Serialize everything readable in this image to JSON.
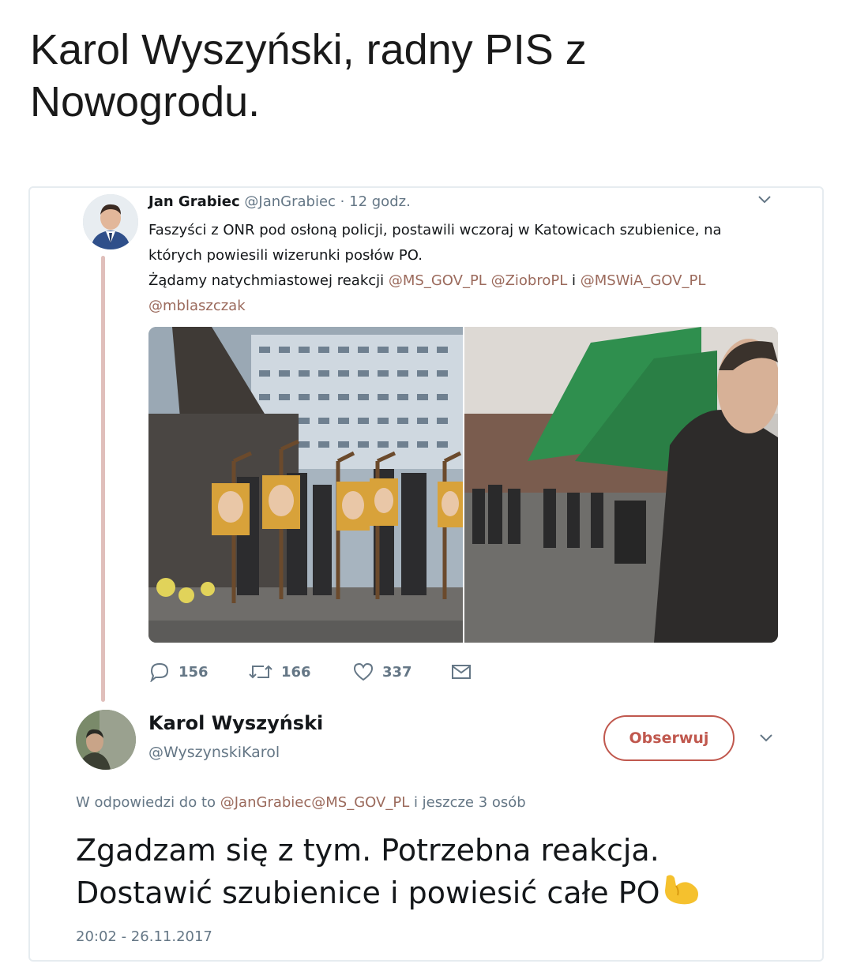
{
  "post": {
    "title": "Karol Wyszyński, radny PIS z Nowogrodu."
  },
  "parent_tweet": {
    "name": "Jan Grabiec",
    "handle": "@JanGrabiec",
    "separator": "·",
    "time": "12 godz.",
    "text_line1": "Faszyści z ONR pod osłoną policji, postawili wczoraj w Katowicach szubienice, na",
    "text_line2": "których powiesili wizerunki posłów PO.",
    "text_line3_prefix": "Żądamy natychmiastowej reakcji ",
    "mention_ms": "@MS_GOV_PL",
    "mention_ziobro": "@ZiobroPL",
    "conj_i": " i ",
    "mention_mswia": "@MSWiA_GOV_PL",
    "mention_mblaszczak": "@mblaszczak",
    "replies": "156",
    "retweets": "166",
    "likes": "337"
  },
  "reply_tweet": {
    "name": "Karol Wyszyński",
    "handle": "@WyszynskiKarol",
    "follow_label": "Obserwuj",
    "in_reply_prefix": "W odpowiedzi do to ",
    "in_reply_mentions": "@JanGrabiec@MS_GOV_PL",
    "in_reply_suffix": " i jeszcze 3 osób",
    "text_line1": "Zgadzam się z tym. Potrzebna reakcja.",
    "text_line2": "Dostawić szubienice i powiesić całe PO",
    "emoji": "flexed-biceps",
    "timestamp": "20:02 - 26.11.2017"
  },
  "icons": {
    "reply": "reply-icon",
    "retweet": "retweet-icon",
    "like": "heart-icon",
    "dm": "envelope-icon",
    "caret": "chevron-down-icon"
  },
  "colors": {
    "accent": "#c0584e",
    "mention": "#9b6a5c",
    "muted": "#657786",
    "thread": "#e0bfbb"
  }
}
